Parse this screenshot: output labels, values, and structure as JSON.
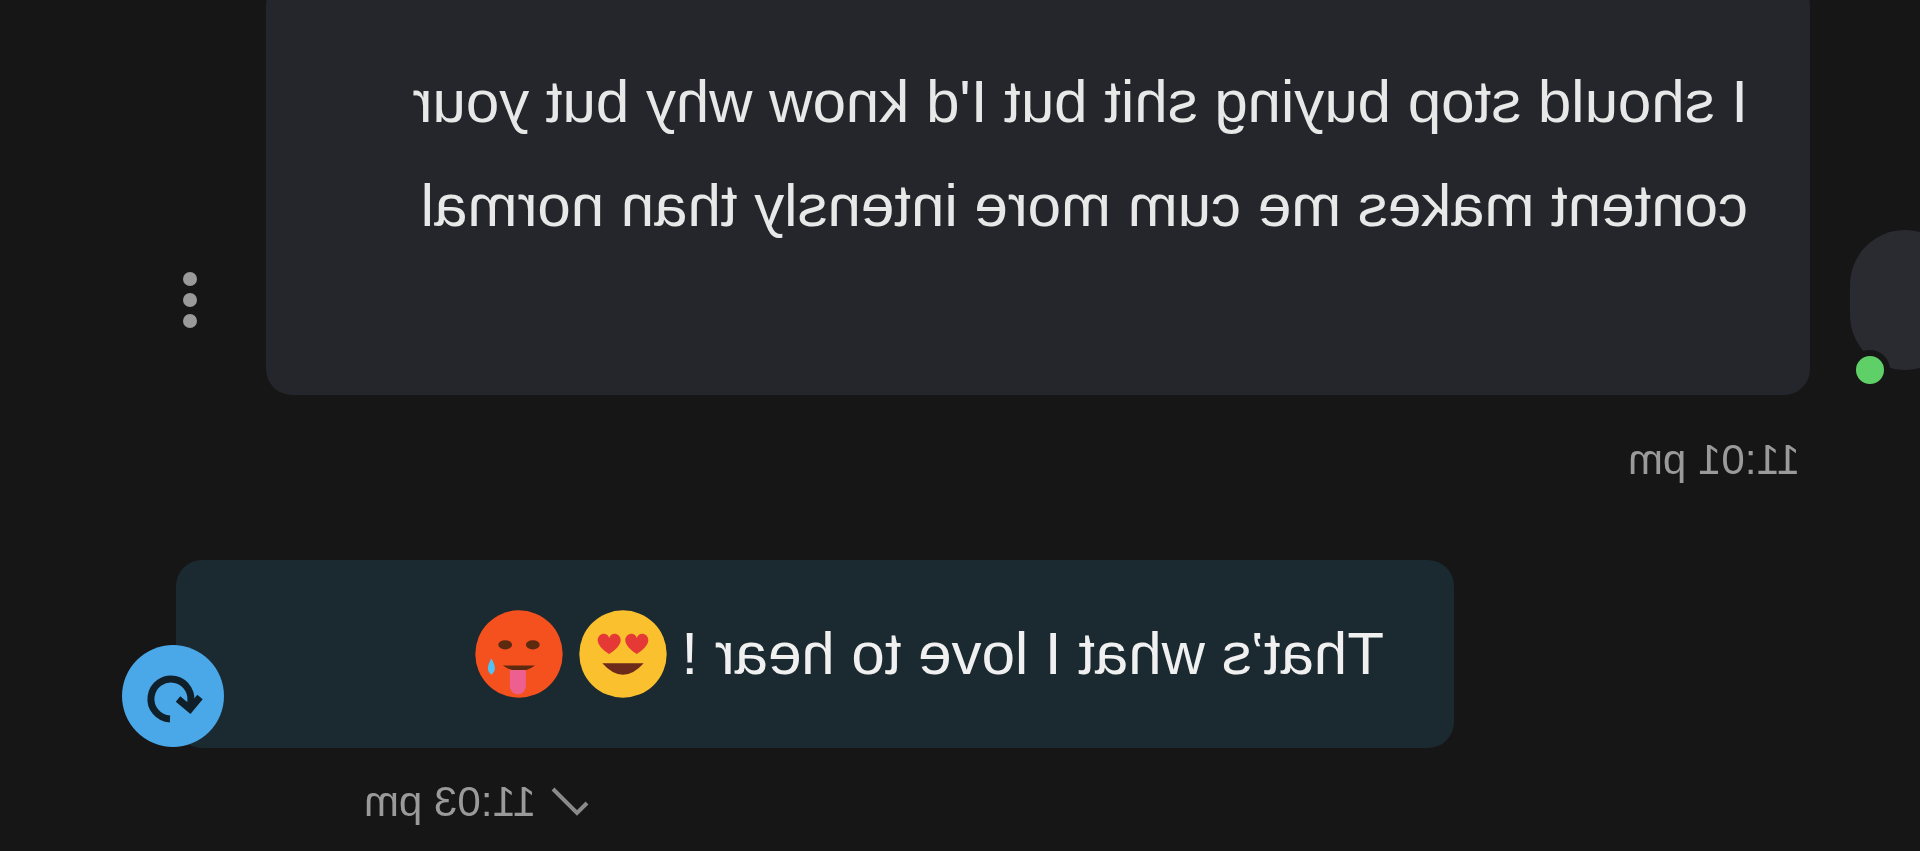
{
  "messages": [
    {
      "kind": "received",
      "text": "I should stop buying shit but I'd know why but your content makes me cum more intensly than normal",
      "time": "11:01 pm",
      "online": true
    },
    {
      "kind": "sent",
      "text": "That’s what I love to hear !",
      "time": "11:03 pm",
      "read": true
    }
  ]
}
